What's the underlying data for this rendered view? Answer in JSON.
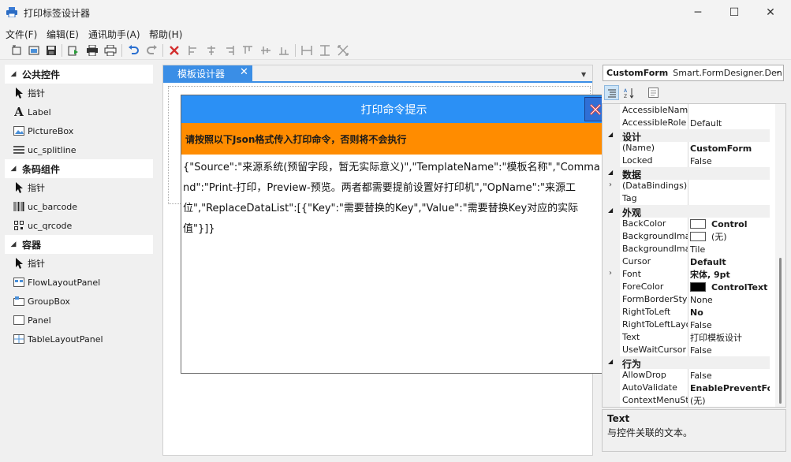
{
  "window": {
    "title": "打印标签设计器",
    "controls": [
      "─",
      "☐",
      "✕"
    ]
  },
  "menu": [
    "文件(F)",
    "编辑(E)",
    "通讯助手(A)",
    "帮助(H)"
  ],
  "toolbar": {
    "icons": [
      "new-icon",
      "open-icon",
      "save-icon",
      "print-preview-icon",
      "print-setup-icon",
      "print-icon",
      "undo-icon",
      "redo-icon",
      "delete-icon",
      "align-left-icon",
      "align-center-icon",
      "align-right-icon",
      "align-top-icon",
      "align-middle-icon",
      "align-bottom-icon",
      "same-width-icon",
      "same-height-icon",
      "same-size-icon"
    ]
  },
  "toolbox": {
    "groups": [
      {
        "title": "公共控件",
        "items": [
          "指针",
          "Label",
          "PictureBox",
          "uc_splitline"
        ]
      },
      {
        "title": "条码组件",
        "items": [
          "指针",
          "uc_barcode",
          "uc_qrcode"
        ]
      },
      {
        "title": "容器",
        "items": [
          "指针",
          "FlowLayoutPanel",
          "GroupBox",
          "Panel",
          "TableLayoutPanel"
        ]
      }
    ]
  },
  "designer": {
    "tab_label": "模板设计器",
    "tab_close": "✕"
  },
  "dialog": {
    "title": "打印命令提示",
    "banner": "请按照以下Json格式传入打印命令，否则将不会执行",
    "body": "{\"Source\":\"来源系统(预留字段，暂无实际意义)\",\"TemplateName\":\"模板名称\",\"Command\":\"Print-打印，Preview-预览。两者都需要提前设置好打印机\",\"OpName\":\"来源工位\",\"ReplaceDataList\":[{\"Key\":\"需要替换的Key\",\"Value\":\"需要替换Key对应的实际值\"}]}",
    "close_color": "#d32f2f"
  },
  "properties": {
    "object_name": "CustomForm",
    "object_class": "Smart.FormDesigner.Den",
    "rows": [
      {
        "type": "prop",
        "name": "AccessibleName",
        "value": ""
      },
      {
        "type": "prop",
        "name": "AccessibleRole",
        "value": "Default"
      },
      {
        "type": "cat",
        "name": "设计"
      },
      {
        "type": "prop",
        "name": "(Name)",
        "value": "CustomForm",
        "bold": true
      },
      {
        "type": "prop",
        "name": "Locked",
        "value": "False"
      },
      {
        "type": "cat",
        "name": "数据"
      },
      {
        "type": "prop",
        "name": "(DataBindings)",
        "value": "",
        "expand": true
      },
      {
        "type": "prop",
        "name": "Tag",
        "value": ""
      },
      {
        "type": "cat",
        "name": "外观"
      },
      {
        "type": "prop",
        "name": "BackColor",
        "value": "Control",
        "bold": true,
        "swatch": "#ffffff"
      },
      {
        "type": "prop",
        "name": "BackgroundImag",
        "value": "(无)",
        "swatch": "#ffffff"
      },
      {
        "type": "prop",
        "name": "BackgroundImag",
        "value": "Tile"
      },
      {
        "type": "prop",
        "name": "Cursor",
        "value": "Default",
        "bold": true
      },
      {
        "type": "prop",
        "name": "Font",
        "value": "宋体, 9pt",
        "bold": true,
        "expand": true
      },
      {
        "type": "prop",
        "name": "ForeColor",
        "value": "ControlText",
        "bold": true,
        "swatch": "#000000"
      },
      {
        "type": "prop",
        "name": "FormBorderStyle",
        "value": "None"
      },
      {
        "type": "prop",
        "name": "RightToLeft",
        "value": "No",
        "bold": true
      },
      {
        "type": "prop",
        "name": "RightToLeftLayo",
        "value": "False"
      },
      {
        "type": "prop",
        "name": "Text",
        "value": "打印模板设计"
      },
      {
        "type": "prop",
        "name": "UseWaitCursor",
        "value": "False"
      },
      {
        "type": "cat",
        "name": "行为"
      },
      {
        "type": "prop",
        "name": "AllowDrop",
        "value": "False"
      },
      {
        "type": "prop",
        "name": "AutoValidate",
        "value": "EnablePreventFoc",
        "bold": true
      },
      {
        "type": "prop",
        "name": "ContextMenuStr",
        "value": "(无)"
      }
    ],
    "help_title": "Text",
    "help_desc": "与控件关联的文本。"
  }
}
